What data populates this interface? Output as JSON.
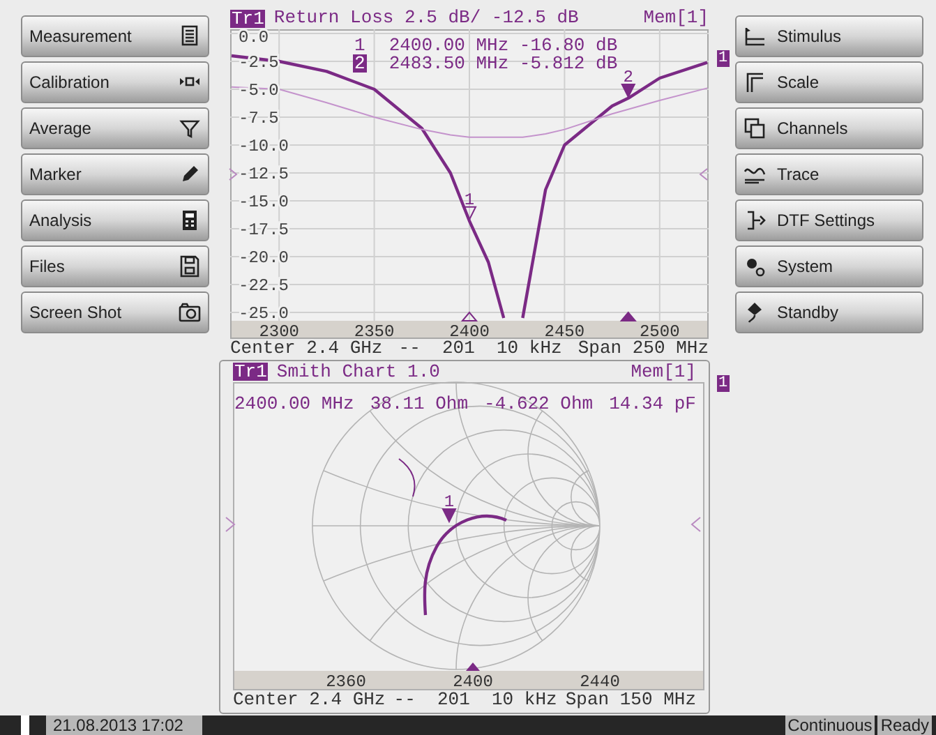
{
  "left_menu": [
    {
      "label": "Measurement"
    },
    {
      "label": "Calibration"
    },
    {
      "label": "Average"
    },
    {
      "label": "Marker"
    },
    {
      "label": "Analysis"
    },
    {
      "label": "Files"
    },
    {
      "label": "Screen Shot"
    }
  ],
  "right_menu": [
    {
      "label": "Stimulus"
    },
    {
      "label": "Scale"
    },
    {
      "label": "Channels"
    },
    {
      "label": "Trace"
    },
    {
      "label": "DTF Settings"
    },
    {
      "label": "System"
    },
    {
      "label": "Standby"
    }
  ],
  "trace_chart": {
    "title": "Return Loss 2.5 dB/ -12.5 dB",
    "channel_badge": "1",
    "markers": [
      {
        "number": "1",
        "readout": "2400.00 MHz -16.80 dB",
        "plot_label": "1",
        "selected": false
      },
      {
        "number": "2",
        "readout": "2483.50 MHz -5.812 dB",
        "plot_label": "2",
        "selected": true
      }
    ],
    "chart_data": {
      "type": "line",
      "grid": true,
      "x": [
        2275,
        2300,
        2325,
        2350,
        2375,
        2390,
        2400,
        2410,
        2418,
        2423,
        2428,
        2440,
        2450,
        2475,
        2483.5,
        2500,
        2525
      ],
      "series": [
        {
          "name": "Tr1",
          "color": "#7b2a85",
          "values": [
            -2.0,
            -2.5,
            -3.4,
            -5.0,
            -8.5,
            -12.5,
            -16.8,
            -20.5,
            -25.5,
            null,
            -25.5,
            -14,
            -10,
            -6.5,
            -5.8,
            -4.0,
            -2.6
          ]
        },
        {
          "name": "Mem[1]",
          "color": "#c493cc",
          "values": [
            -4.8,
            -5.0,
            -6.2,
            -7.5,
            -8.6,
            -9.1,
            -9.3,
            -9.3,
            -9.3,
            -9.3,
            -9.3,
            -9.0,
            -8.6,
            -7.2,
            -6.8,
            -6.0,
            -4.9
          ]
        }
      ],
      "xlim": [
        2275,
        2525
      ],
      "ylim": [
        -25.75,
        0.375
      ],
      "xticks": [
        2300,
        2350,
        2400,
        2450,
        2500
      ],
      "yticks": [
        {
          "value": 0,
          "label": "0.0"
        },
        {
          "value": -2.5,
          "label": "-2.5"
        },
        {
          "value": -5,
          "label": "-5.0"
        },
        {
          "value": -7.5,
          "label": "-7.5"
        },
        {
          "value": -10,
          "label": "-10.0"
        },
        {
          "value": -12.5,
          "label": "-12.5"
        },
        {
          "value": -15,
          "label": "-15.0"
        },
        {
          "value": -17.5,
          "label": "-17.5"
        },
        {
          "value": -20,
          "label": "-20.0"
        },
        {
          "value": -22.5,
          "label": "-22.5"
        },
        {
          "value": -25,
          "label": "-25.0"
        }
      ]
    },
    "footer": [
      "Center 2.4 GHz",
      "--  201  10 kHz",
      "Span 250 MHz"
    ]
  },
  "smith_chart": {
    "trace_badge": "Tr1",
    "title": "Smith Chart 1.0",
    "memory": "Mem[1]",
    "channel_badge": "1",
    "readout": [
      "2400.00 MHz",
      "38.11 Ohm",
      "-4.622 Ohm",
      "14.34 pF"
    ],
    "marker_label": "1",
    "x_ticks": [
      "2360",
      "2400",
      "2440"
    ],
    "footer": [
      "Center 2.4 GHz",
      "--  201  10 kHz",
      "Span 150 MHz"
    ]
  },
  "status_bar": {
    "datetime": "21.08.2013 17:02",
    "mode": "Continuous",
    "state": "Ready"
  }
}
